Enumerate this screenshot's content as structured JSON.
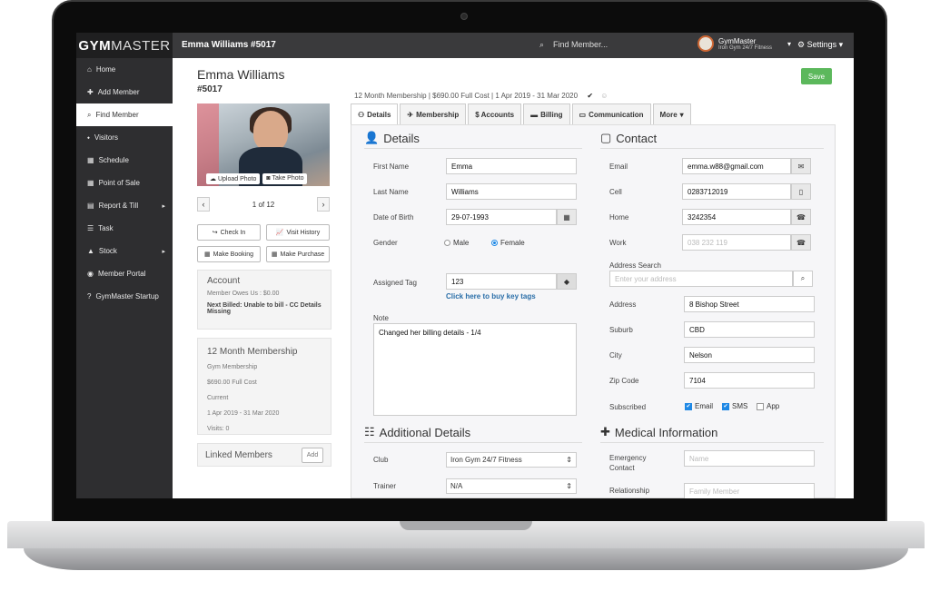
{
  "topbar": {
    "logo_bold": "GYM",
    "logo_light": "MASTER",
    "title": "Emma Williams #5017",
    "search_placeholder": "Find Member...",
    "club_name": "GymMaster",
    "club_sub": "Iron Gym 24/7 Fitness",
    "settings_label": "Settings"
  },
  "sidebar": {
    "items": [
      {
        "label": "Home",
        "icon": "⌂"
      },
      {
        "label": "Add Member",
        "icon": "✚"
      },
      {
        "label": "Find Member",
        "icon": "⌕"
      },
      {
        "label": "Visitors",
        "icon": "⬩"
      },
      {
        "label": "Schedule",
        "icon": "▦"
      },
      {
        "label": "Point of Sale",
        "icon": "▦"
      },
      {
        "label": "Report & Till",
        "icon": "▤"
      },
      {
        "label": "Task",
        "icon": "☰"
      },
      {
        "label": "Stock",
        "icon": "▲"
      },
      {
        "label": "Member Portal",
        "icon": "◉"
      },
      {
        "label": "GymMaster Startup",
        "icon": "?"
      }
    ]
  },
  "member": {
    "name": "Emma Williams",
    "id": "#5017",
    "save_label": "Save",
    "upload_photo": "Upload Photo",
    "take_photo": "Take Photo",
    "pager_text": "1 of 12",
    "buttons": [
      "Check In",
      "Visit History",
      "Make Booking",
      "Make Purchase"
    ]
  },
  "account": {
    "title": "Account",
    "owes": "Member Owes Us : $0.00",
    "next_billed": "Next Billed: Unable to bill - CC Details Missing"
  },
  "membership": {
    "title": "12 Month Membership",
    "type": "Gym Membership",
    "cost": "$690.00 Full Cost",
    "status": "Current",
    "dates": "1 Apr 2019 - 31 Mar 2020",
    "visits": "Visits: 0"
  },
  "linked": {
    "title": "Linked Members",
    "add_label": "Add"
  },
  "summary": {
    "text": "12 Month Membership  |  $690.00 Full Cost  |  1 Apr 2019 - 31 Mar 2020",
    "check": "✔",
    "smile": "☺"
  },
  "tabs": [
    {
      "label": "Details",
      "icon": "▾"
    },
    {
      "label": "Membership",
      "icon": "🏃"
    },
    {
      "label": "$ Accounts",
      "icon": ""
    },
    {
      "label": "Billing",
      "icon": "▬"
    },
    {
      "label": "Communication",
      "icon": "▭"
    },
    {
      "label": "More",
      "icon": ""
    }
  ],
  "details": {
    "heading": "Details",
    "first_name_label": "First Name",
    "first_name": "Emma",
    "last_name_label": "Last Name",
    "last_name": "Williams",
    "dob_label": "Date of Birth",
    "dob": "29-07-1993",
    "gender_label": "Gender",
    "male": "Male",
    "female": "Female",
    "tag_label": "Assigned Tag",
    "tag": "123",
    "tag_link": "Click here to buy key tags",
    "note_label": "Note",
    "note": "Changed her billing details - 1/4"
  },
  "contact": {
    "heading": "Contact",
    "email_label": "Email",
    "email": "emma.w88@gmail.com",
    "cell_label": "Cell",
    "cell": "0283712019",
    "home_label": "Home",
    "home": "3242354",
    "work_label": "Work",
    "work_placeholder": "038 232 119",
    "address_search_label": "Address Search",
    "address_search_placeholder": "Enter your address",
    "address_label": "Address",
    "address": "8 Bishop Street",
    "suburb_label": "Suburb",
    "suburb": "CBD",
    "city_label": "City",
    "city": "Nelson",
    "zip_label": "Zip Code",
    "zip": "7104",
    "subscribed_label": "Subscribed",
    "sub_email": "Email",
    "sub_sms": "SMS",
    "sub_app": "App"
  },
  "additional": {
    "heading": "Additional Details",
    "club_label": "Club",
    "club": "Iron Gym 24/7 Fitness",
    "trainer_label": "Trainer",
    "trainer": "N/A"
  },
  "medical": {
    "heading": "Medical Information",
    "emergency_label": "Emergency Contact",
    "emergency_placeholder": "Name",
    "relationship_label": "Relationship",
    "relationship_placeholder": "Family Member"
  }
}
